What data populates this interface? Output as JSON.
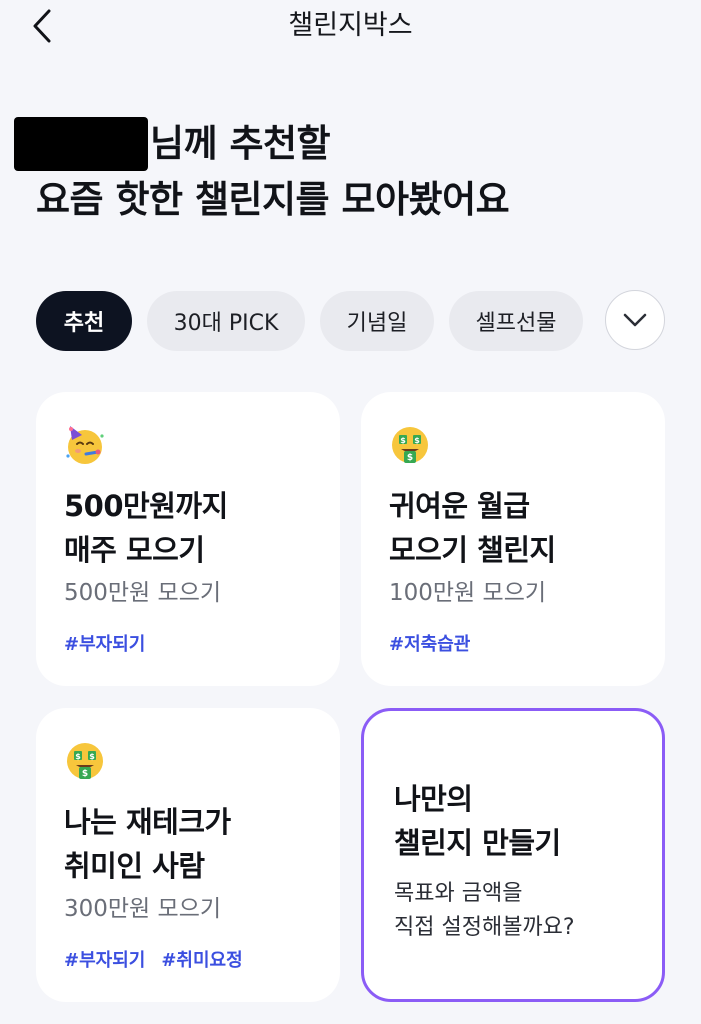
{
  "header": {
    "title": "챌린지박스"
  },
  "headline": {
    "line1_suffix": "님께 추천할",
    "line2": "요즘 핫한 챌린지를 모아봤어요"
  },
  "chips": [
    "추천",
    "30대 PICK",
    "기념일",
    "셀프선물"
  ],
  "cards": [
    {
      "emoji": "partying-face-icon",
      "title_line1": "500만원까지",
      "title_line2": "매주 모으기",
      "subtitle": "500만원 모으기",
      "tags": [
        "#부자되기"
      ]
    },
    {
      "emoji": "money-mouth-face-icon",
      "title_line1": "귀여운 월급",
      "title_line2": "모으기 챌린지",
      "subtitle": "100만원 모으기",
      "tags": [
        "#저축습관"
      ]
    },
    {
      "emoji": "money-mouth-face-icon",
      "title_line1": "나는 재테크가",
      "title_line2": "취미인 사람",
      "subtitle": "300만원 모으기",
      "tags": [
        "#부자되기",
        "#취미요정"
      ]
    }
  ],
  "custom_card": {
    "title_line1": "나만의",
    "title_line2": "챌린지 만들기",
    "desc_line1": "목표와 금액을",
    "desc_line2": "직접 설정해볼까요?"
  },
  "colors": {
    "background": "#f5f6fa",
    "active_chip": "#0d1321",
    "tag": "#3b4fe0",
    "custom_border": "#8b5cf6"
  }
}
